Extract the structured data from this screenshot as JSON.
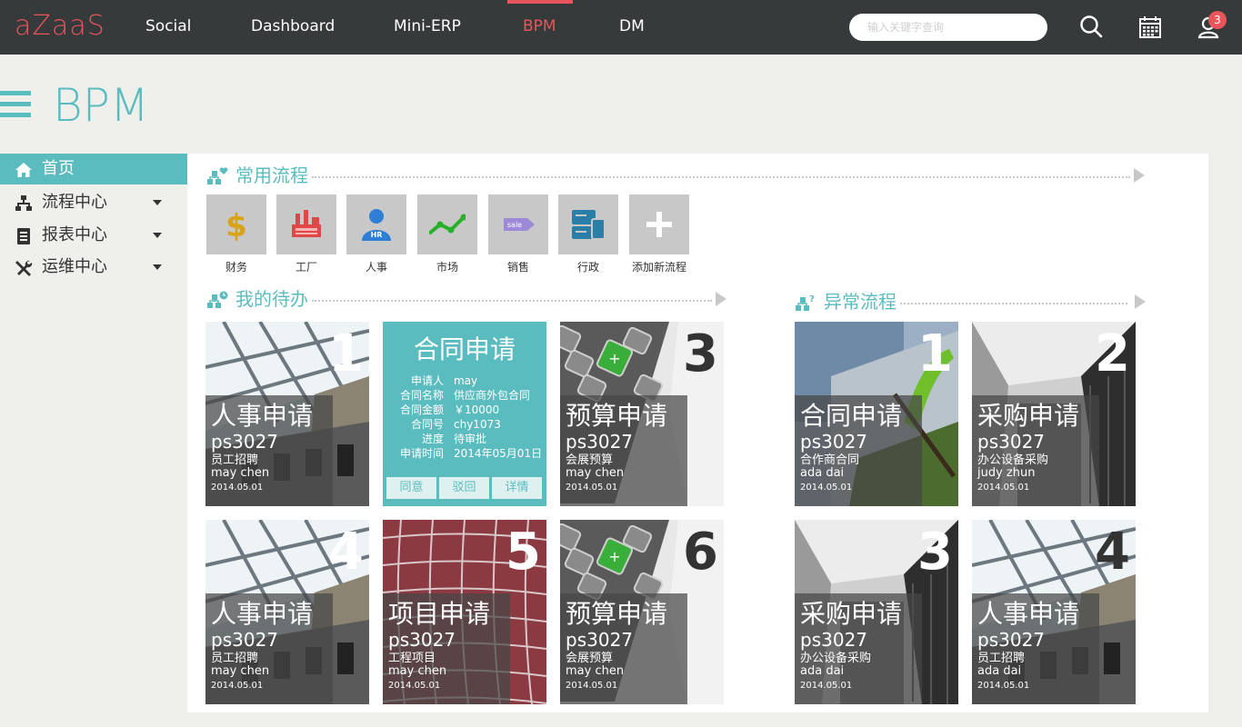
{
  "topnav": {
    "logo": "aZaaS",
    "items": [
      {
        "label": "Social"
      },
      {
        "label": "Dashboard"
      },
      {
        "label": "Mini-ERP"
      },
      {
        "label": "BPM"
      },
      {
        "label": "DM"
      }
    ],
    "active": "BPM",
    "search_placeholder": "输入关键字查询",
    "notification_count": "3",
    "colors": {
      "bar": "#363a3b",
      "accent": "#e8555a"
    }
  },
  "header": {
    "title": "BPM",
    "accent": "#5bbcbf"
  },
  "sidebar": {
    "items": [
      {
        "label": "首页",
        "icon": "home-icon",
        "active": true
      },
      {
        "label": "流程中心",
        "icon": "sitemap-icon"
      },
      {
        "label": "报表中心",
        "icon": "report-icon"
      },
      {
        "label": "运维中心",
        "icon": "tools-icon"
      }
    ]
  },
  "sections": {
    "common": {
      "title": "常用流程"
    },
    "todo": {
      "title": "我的待办"
    },
    "abnormal": {
      "title": "异常流程"
    }
  },
  "quick_flows": [
    {
      "label": "财务",
      "icon": "dollar-icon"
    },
    {
      "label": "工厂",
      "icon": "factory-icon"
    },
    {
      "label": "人事",
      "icon": "hr-person-icon"
    },
    {
      "label": "市场",
      "icon": "trend-line-icon"
    },
    {
      "label": "销售",
      "icon": "sale-tag-icon"
    },
    {
      "label": "行政",
      "icon": "admin-cards-icon"
    },
    {
      "label": "添加新流程",
      "icon": "plus-icon"
    }
  ],
  "todo_tiles": [
    {
      "num": "1",
      "title": "人事申请",
      "code": "ps3027",
      "desc": "员工招聘",
      "user": "may chen",
      "date": "2014.05.01"
    },
    {
      "num": "",
      "title": "合同申请",
      "detail": [
        {
          "k": "申请人",
          "v": "may"
        },
        {
          "k": "合同名称",
          "v": "供应商外包合同"
        },
        {
          "k": "合同金额",
          "v": "￥10000"
        },
        {
          "k": "合同号",
          "v": "chy1073"
        },
        {
          "k": "进度",
          "v": "待审批"
        },
        {
          "k": "申请时间",
          "v": "2014年05月01日"
        }
      ],
      "buttons": [
        "同意",
        "驳回",
        "详情"
      ]
    },
    {
      "num": "3",
      "title": "预算申请",
      "code": "ps3027",
      "desc": "会展预算",
      "user": "may chen",
      "date": "2014.05.01"
    },
    {
      "num": "4",
      "title": "人事申请",
      "code": "ps3027",
      "desc": "员工招聘",
      "user": "may chen",
      "date": "2014.05.01"
    },
    {
      "num": "5",
      "title": "项目申请",
      "code": "ps3027",
      "desc": "工程项目",
      "user": "may chen",
      "date": "2014.05.01"
    },
    {
      "num": "6",
      "title": "预算申请",
      "code": "ps3027",
      "desc": "会展预算",
      "user": "may chen",
      "date": "2014.05.01"
    }
  ],
  "abnormal_tiles": [
    {
      "num": "1",
      "title": "合同申请",
      "code": "ps3027",
      "desc": "合作商合同",
      "user": "ada dai",
      "date": "2014.05.01"
    },
    {
      "num": "2",
      "title": "采购申请",
      "code": "ps3027",
      "desc": "办公设备采购",
      "user": "judy zhun",
      "date": "2014.05.01"
    },
    {
      "num": "3",
      "title": "采购申请",
      "code": "ps3027",
      "desc": "办公设备采购",
      "user": "ada dai",
      "date": "2014.05.01"
    },
    {
      "num": "4",
      "title": "人事申请",
      "code": "ps3027",
      "desc": "员工招聘",
      "user": "ada dai",
      "date": "2014.05.01"
    }
  ]
}
